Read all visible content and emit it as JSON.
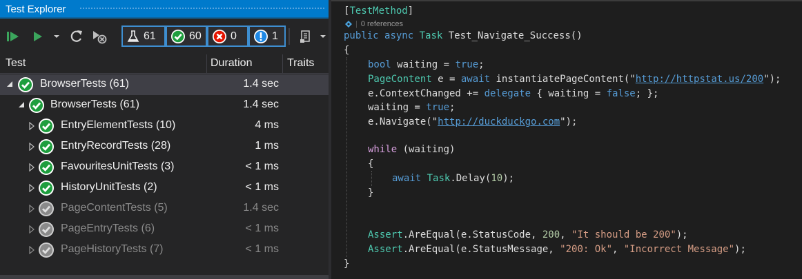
{
  "test_explorer": {
    "title": "Test Explorer",
    "counters": {
      "total": "61",
      "passed": "60",
      "failed": "0",
      "not_run": "1"
    },
    "columns": {
      "test": "Test",
      "duration": "Duration",
      "traits": "Traits"
    },
    "rows": [
      {
        "name": "BrowserTests (61)",
        "duration": "1.4 sec"
      },
      {
        "name": "BrowserTests (61)",
        "duration": "1.4 sec"
      },
      {
        "name": "EntryElementTests (10)",
        "duration": "4 ms"
      },
      {
        "name": "EntryRecordTests (28)",
        "duration": "1 ms"
      },
      {
        "name": "FavouritesUnitTests (3)",
        "duration": "< 1 ms"
      },
      {
        "name": "HistoryUnitTests (2)",
        "duration": "< 1 ms"
      },
      {
        "name": "PageContentTests (5)",
        "duration": "1.4 sec"
      },
      {
        "name": "PageEntryTests (6)",
        "duration": "< 1 ms"
      },
      {
        "name": "PageHistoryTests (7)",
        "duration": "< 1 ms"
      }
    ]
  },
  "editor": {
    "attribute": "TestMethod",
    "codelens_references": "0 references",
    "lines": {
      "l1_mod1": "public",
      "l1_mod2": "async",
      "l1_type": "Task",
      "l1_name": " Test_Navigate_Success()",
      "l2": "{",
      "l3_kw": "bool",
      "l3_rest": " waiting = ",
      "l3_val": "true",
      "l3_end": ";",
      "l4_type": "PageContent",
      "l4_a": " e = ",
      "l4_kw": "await",
      "l4_b": " instantiatePageContent(\"",
      "l4_url": "http://httpstat.us/200",
      "l4_c": "\");",
      "l5_a": "e.ContextChanged += ",
      "l5_kw": "delegate",
      "l5_b": " { waiting = ",
      "l5_val": "false",
      "l5_c": "; };",
      "l6_a": "waiting = ",
      "l6_val": "true",
      "l6_c": ";",
      "l7_a": "e.Navigate(\"",
      "l7_url": "http://duckduckgo.com",
      "l7_c": "\");",
      "l9_kw": "while",
      "l9_rest": " (waiting)",
      "l10": "{",
      "l11_kw": "await",
      "l11_type": "Task",
      "l11_rest": ".Delay(",
      "l11_num": "10",
      "l11_end": ");",
      "l12": "}",
      "l15_type": "Assert",
      "l15_a": ".AreEqual(e.StatusCode, ",
      "l15_num": "200",
      "l15_b": ", ",
      "l15_str": "\"It should be 200\"",
      "l15_c": ");",
      "l16_type": "Assert",
      "l16_a": ".AreEqual(e.StatusMessage, ",
      "l16_str1": "\"200: Ok\"",
      "l16_b": ", ",
      "l16_str2": "\"Incorrect Message\"",
      "l16_c": ");",
      "l17": "}"
    }
  },
  "colors": {
    "title_bar": "#007acc",
    "pass_green": "#1e9e3e",
    "fail_red": "#e51400",
    "info_blue": "#1e88e5"
  }
}
